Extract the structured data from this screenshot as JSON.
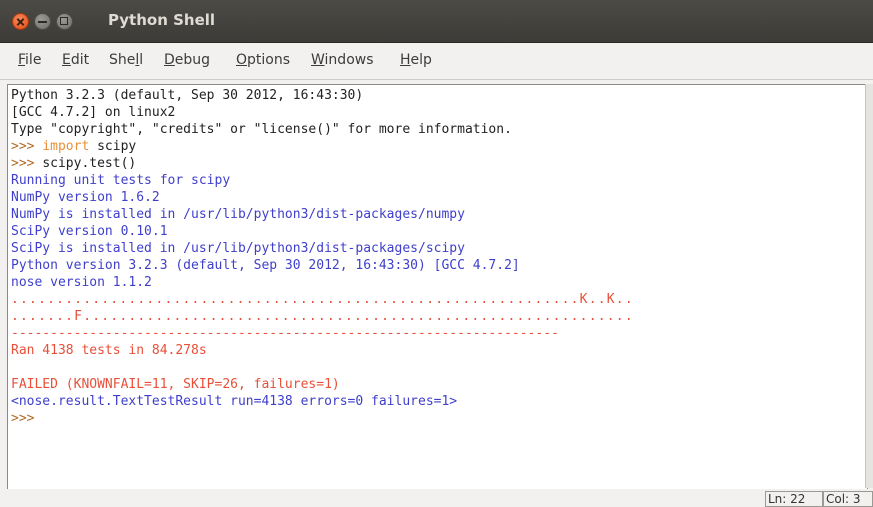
{
  "window": {
    "title": "Python Shell"
  },
  "menu": [
    {
      "pre": "",
      "u": "F",
      "post": "ile"
    },
    {
      "pre": "",
      "u": "E",
      "post": "dit"
    },
    {
      "pre": "She",
      "u": "l",
      "post": "l"
    },
    {
      "pre": "",
      "u": "D",
      "post": "ebug"
    },
    {
      "pre": "",
      "u": "O",
      "post": "ptions"
    },
    {
      "pre": "",
      "u": "W",
      "post": "indows"
    },
    {
      "pre": "",
      "u": "H",
      "post": "elp"
    }
  ],
  "shell": {
    "lines": [
      "Python 3.2.3 (default, Sep 30 2012, 16:43:30)",
      "[GCC 4.7.2] on linux2",
      "Type \"copyright\", \"credits\" or \"license()\" for more information.",
      ">>> import scipy",
      ">>> scipy.test()",
      "Running unit tests for scipy",
      "NumPy version 1.6.2",
      "NumPy is installed in /usr/lib/python3/dist-packages/numpy",
      "SciPy version 0.10.1",
      "SciPy is installed in /usr/lib/python3/dist-packages/scipy",
      "Python version 3.2.3 (default, Sep 30 2012, 16:43:30) [GCC 4.7.2]",
      "nose version 1.1.2",
      "...............................................................K..K..",
      ".......F.............................................................",
      "----------------------------------------------------------------------",
      "Ran 4138 tests in 84.278s",
      "",
      "FAILED (KNOWNFAIL=11, SKIP=26, failures=1)",
      "<nose.result.TextTestResult run=4138 errors=0 failures=1>",
      ">>> "
    ]
  },
  "status": {
    "line": "Ln: 22",
    "col": "Col: 3"
  }
}
